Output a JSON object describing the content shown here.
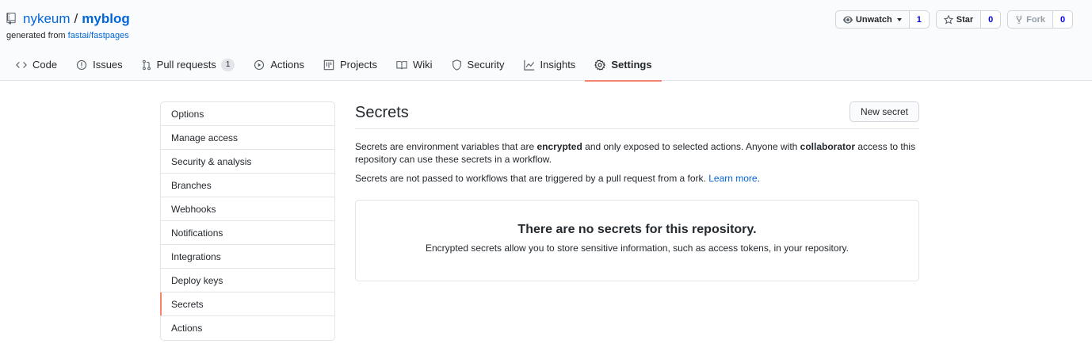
{
  "repo": {
    "owner": "nykeum",
    "slash": "/",
    "name": "myblog",
    "generated_prefix": "generated from",
    "template_link": "fastai/fastpages"
  },
  "header_actions": {
    "watch": {
      "label": "Unwatch",
      "count": "1"
    },
    "star": {
      "label": "Star",
      "count": "0"
    },
    "fork": {
      "label": "Fork",
      "count": "0"
    }
  },
  "tabs": [
    {
      "label": "Code",
      "icon": "code-icon"
    },
    {
      "label": "Issues",
      "icon": "issue-icon"
    },
    {
      "label": "Pull requests",
      "icon": "pull-request-icon",
      "counter": "1"
    },
    {
      "label": "Actions",
      "icon": "play-icon"
    },
    {
      "label": "Projects",
      "icon": "project-icon"
    },
    {
      "label": "Wiki",
      "icon": "book-icon"
    },
    {
      "label": "Security",
      "icon": "shield-icon"
    },
    {
      "label": "Insights",
      "icon": "graph-icon"
    },
    {
      "label": "Settings",
      "icon": "gear-icon",
      "selected": true
    }
  ],
  "sidebar": {
    "items": [
      {
        "label": "Options"
      },
      {
        "label": "Manage access"
      },
      {
        "label": "Security & analysis"
      },
      {
        "label": "Branches"
      },
      {
        "label": "Webhooks"
      },
      {
        "label": "Notifications"
      },
      {
        "label": "Integrations"
      },
      {
        "label": "Deploy keys"
      },
      {
        "label": "Secrets",
        "selected": true
      },
      {
        "label": "Actions"
      }
    ]
  },
  "main": {
    "title": "Secrets",
    "new_button": "New secret",
    "desc": {
      "part1": "Secrets are environment variables that are ",
      "bold1": "encrypted",
      "part2": " and only exposed to selected actions. Anyone with ",
      "bold2": "collaborator",
      "part3": " access to this repository can use these secrets in a workflow."
    },
    "desc2": {
      "text": "Secrets are not passed to workflows that are triggered by a pull request from a fork. ",
      "link": "Learn more",
      "end": "."
    },
    "blankslate": {
      "heading": "There are no secrets for this repository.",
      "text": "Encrypted secrets allow you to store sensitive information, such as access tokens, in your repository."
    }
  },
  "colors": {
    "link": "#0366d6",
    "accent": "#f9826c",
    "border": "#e1e4e8",
    "header_bg": "#fafbfc"
  }
}
